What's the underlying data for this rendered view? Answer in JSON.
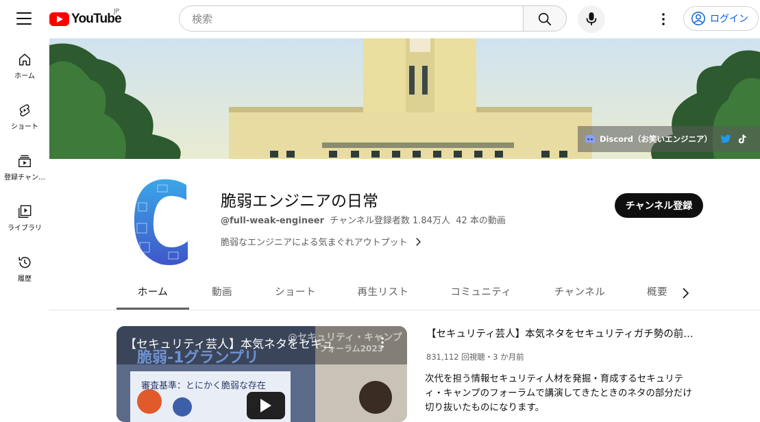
{
  "header": {
    "logo_text": "YouTube",
    "region": "JP",
    "search_placeholder": "検索",
    "login_label": "ログイン"
  },
  "guide": {
    "items": [
      {
        "label": "ホーム",
        "icon": "home-icon"
      },
      {
        "label": "ショート",
        "icon": "shorts-icon"
      },
      {
        "label": "登録チャン…",
        "icon": "subscriptions-icon"
      },
      {
        "label": "ライブラリ",
        "icon": "library-icon"
      },
      {
        "label": "履歴",
        "icon": "history-icon"
      }
    ]
  },
  "banner": {
    "link_label": "Discord（お笑いエンジニア）",
    "link_icons": [
      "discord-icon",
      "twitter-icon",
      "tiktok-icon"
    ]
  },
  "channel": {
    "name": "脆弱エンジニアの日常",
    "handle": "@full-weak-engineer",
    "subscribers": "チャンネル登録者数 1.84万人",
    "videos": "42 本の動画",
    "description": "脆弱なエンジニアによる気まぐれアウトプット",
    "subscribe_label": "チャンネル登録"
  },
  "tabs": [
    {
      "label": "ホーム",
      "active": true
    },
    {
      "label": "動画"
    },
    {
      "label": "ショート"
    },
    {
      "label": "再生リスト"
    },
    {
      "label": "コミュニティ"
    },
    {
      "label": "チャンネル"
    },
    {
      "label": "概要"
    }
  ],
  "featured": {
    "overlay_title": "【セキュリティ芸人】本気ネタをセキュ",
    "thumb_headline": "脆弱-1グランプリ",
    "thumb_sub": "審査基準：とにかく脆弱な存在",
    "thumb_event": "@セキュリティ・キャンプ",
    "thumb_event2": "フォーラム2023",
    "title": "【セキュリティ芸人】本気ネタをセキュリティガチ勢の前で…",
    "meta": "831,112 回視聴・3 か月前",
    "description": "次代を担う情報セキュリティ人材を発掘・育成するセキュリティ・キャンプのフォーラムで講演してきたときのネタの部分だけ切り抜いたものになります。"
  },
  "colors": {
    "brand_red": "#ff0000",
    "link_blue": "#065fd4",
    "text_primary": "#0f0f0f",
    "text_secondary": "#606060",
    "subscribe_bg": "#0f0f0f"
  }
}
